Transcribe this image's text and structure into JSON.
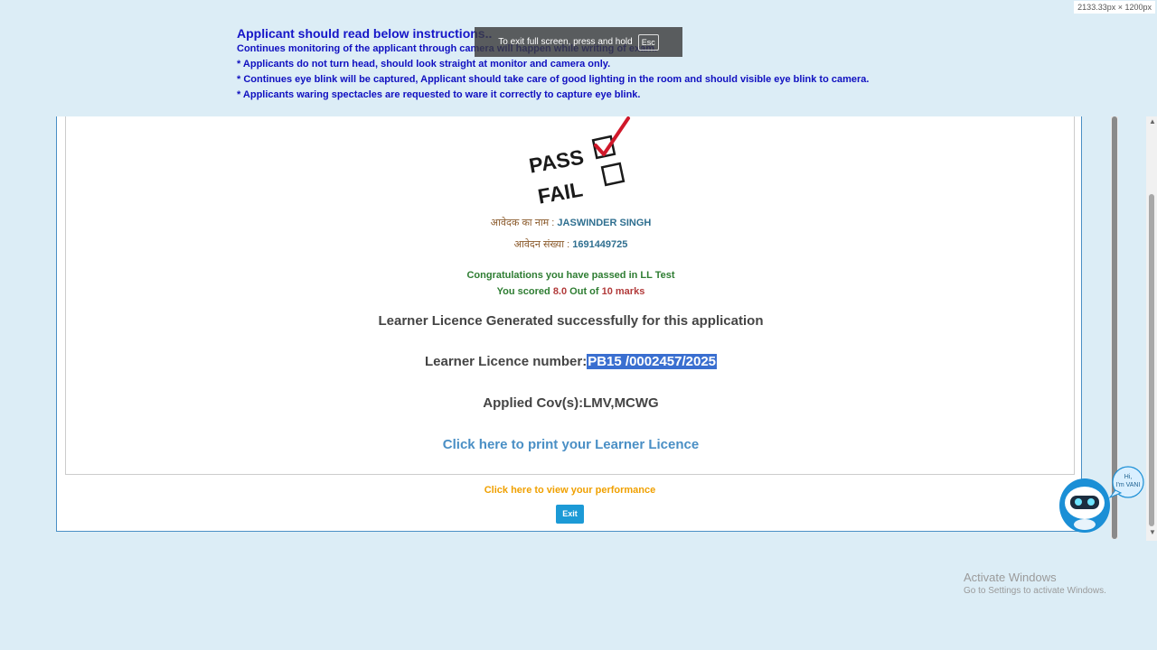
{
  "viewport_badge": "2133.33px × 1200px",
  "instructions": {
    "heading": "Applicant should read below instructions..",
    "lines": [
      "Continues monitoring of the applicant through camera will happen while writing of exam.",
      "* Applicants do not turn head, should look straight at monitor and camera only.",
      "* Continues eye blink will be captured, Applicant should take care of good lighting in the room and should visible eye blink to camera.",
      "* Applicants waring spectacles are requested to ware it correctly to capture eye blink."
    ]
  },
  "fullscreen_toast": {
    "message": "To exit full screen, press and hold",
    "key": "Esc"
  },
  "result_image": {
    "pass_label": "PASS",
    "fail_label": "FAIL"
  },
  "applicant": {
    "name_label": "आवेदक का नाम : ",
    "name_value": "JASWINDER SINGH",
    "app_no_label": "आवेदन संख्या : ",
    "app_no_value": "1691449725"
  },
  "result": {
    "congrats": "Congratulations you have passed in LL Test",
    "score_prefix": "You scored ",
    "score_value": "8.0",
    "score_mid": " Out of ",
    "score_total": "10 marks",
    "generated": "Learner Licence Generated successfully for this application",
    "ll_label": "Learner Licence number:",
    "ll_number": "PB15 /0002457/2025",
    "cov": "Applied Cov(s):LMV,MCWG",
    "print_link": "Click here to print your Learner Licence",
    "performance_link": "Click here to view your performance",
    "exit_button": "Exit"
  },
  "chatbot": {
    "bubble_text_1": "Hi,",
    "bubble_text_2": "I'm VANI",
    "icon": "robot-icon"
  },
  "windows_watermark": {
    "title": "Activate Windows",
    "subtitle": "Go to Settings to activate Windows."
  },
  "colors": {
    "page_bg": "#dcedf6",
    "instruction_text": "#1515c8",
    "panel_border": "#4a8fc5",
    "success_green": "#2e7d32",
    "score_red": "#b23b3b",
    "link_blue": "#4a8fc5",
    "link_orange": "#f0a000",
    "exit_button": "#1c9ad6",
    "selection_highlight": "#3a6fd0"
  }
}
